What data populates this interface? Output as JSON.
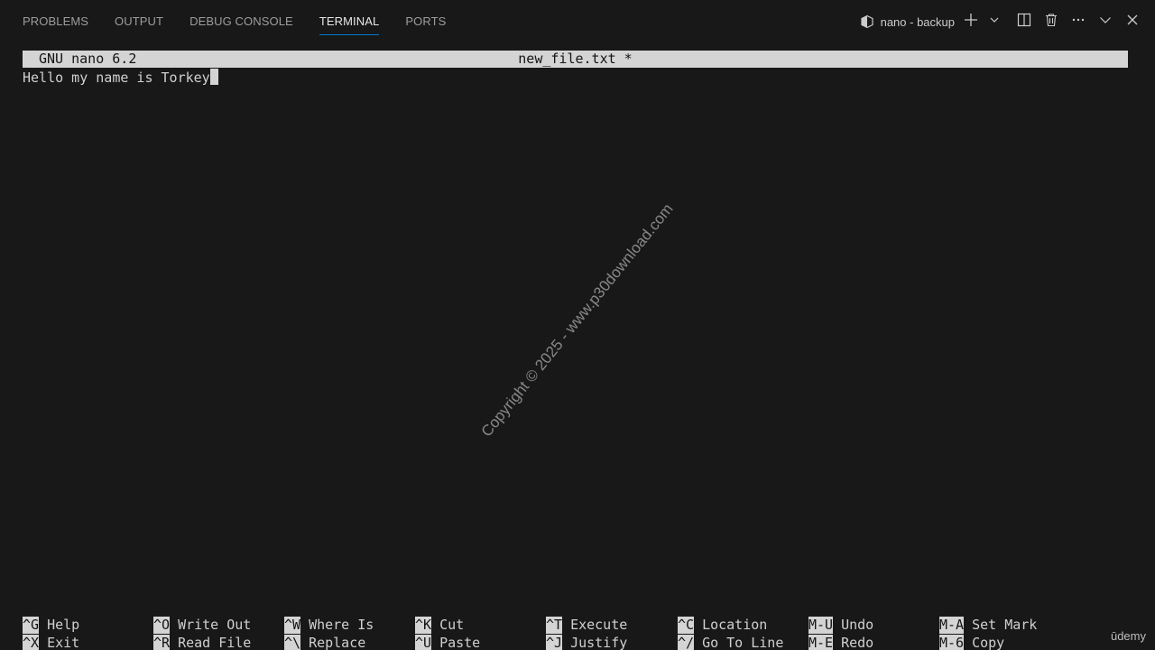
{
  "panel": {
    "tabs": [
      {
        "label": "PROBLEMS",
        "active": false
      },
      {
        "label": "OUTPUT",
        "active": false
      },
      {
        "label": "DEBUG CONSOLE",
        "active": false
      },
      {
        "label": "TERMINAL",
        "active": true
      },
      {
        "label": "PORTS",
        "active": false
      }
    ],
    "terminal_name": "nano - backup",
    "accent_color": "#0078d4"
  },
  "nano": {
    "version": "GNU nano 6.2",
    "filename": "new_file.txt *",
    "content": "Hello my name is Torkey",
    "shortcuts": [
      [
        {
          "key": "^G",
          "label": "Help"
        },
        {
          "key": "^X",
          "label": "Exit"
        }
      ],
      [
        {
          "key": "^O",
          "label": "Write Out"
        },
        {
          "key": "^R",
          "label": "Read File"
        }
      ],
      [
        {
          "key": "^W",
          "label": "Where Is"
        },
        {
          "key": "^\\",
          "label": "Replace"
        }
      ],
      [
        {
          "key": "^K",
          "label": "Cut"
        },
        {
          "key": "^U",
          "label": "Paste"
        }
      ],
      [
        {
          "key": "^T",
          "label": "Execute"
        },
        {
          "key": "^J",
          "label": "Justify"
        }
      ],
      [
        {
          "key": "^C",
          "label": "Location"
        },
        {
          "key": "^/",
          "label": "Go To Line"
        }
      ],
      [
        {
          "key": "M-U",
          "label": "Undo"
        },
        {
          "key": "M-E",
          "label": "Redo"
        }
      ],
      [
        {
          "key": "M-A",
          "label": "Set Mark"
        },
        {
          "key": "M-6",
          "label": "Copy"
        }
      ]
    ]
  },
  "watermark": "Copyright © 2025 - www.p30download.com",
  "brand": "ūdemy",
  "icons": {
    "terminal": "terminal-icon",
    "new": "plus-icon",
    "dropdown": "chevron-down-icon",
    "split": "split-icon",
    "kill": "trash-icon",
    "more": "ellipsis-icon",
    "maximize": "chevron-up-icon",
    "close": "close-icon"
  }
}
